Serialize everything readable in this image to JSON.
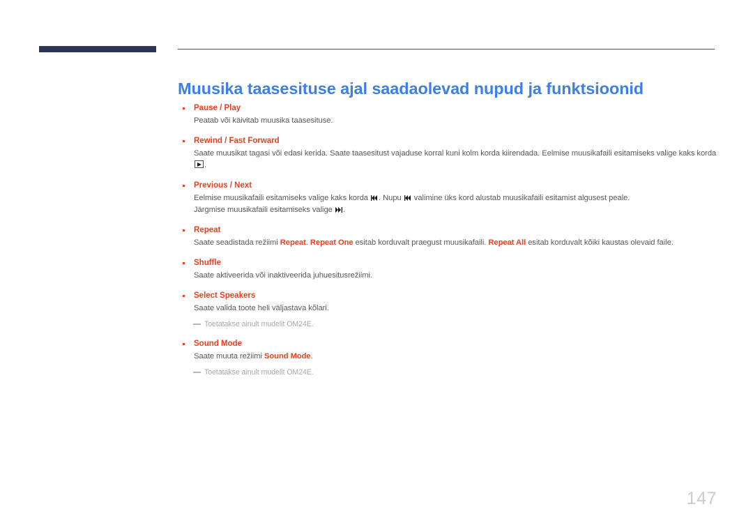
{
  "document": {
    "title": "Muusika taasesituse ajal saadaolevad nupud ja funktsioonid",
    "page_number": "147"
  },
  "colors": {
    "title_blue": "#3d7fe4",
    "accent_orange": "#e8401f",
    "body_gray": "#58585a",
    "note_gray": "#a6a8ab",
    "deco_navy": "#2b3553",
    "page_number_gray": "#c9cbcd"
  },
  "sections": [
    {
      "id": "pause-play",
      "head_primary": "Pause",
      "head_separator": " / ",
      "head_secondary": "Play",
      "lines": [
        {
          "text": "Peatab või käivitab muusika taasesituse."
        }
      ],
      "note": null
    },
    {
      "id": "rewind-fast-forward",
      "head_primary": "Rewind",
      "head_separator": " /  ",
      "head_secondary": "Fast Forward",
      "lines": [
        {
          "text_before": "Saate muusikat tagasi või edasi kerida. Saate taasesitust vajaduse korral kuni kolm korda kiirendada. Eelmise muusikafaili esitamiseks valige kaks korda ",
          "icon": "play-boxed-icon",
          "text_after": "."
        }
      ],
      "note": null
    },
    {
      "id": "previous-next",
      "head_primary": "Previous",
      "head_separator": " / ",
      "head_secondary": "Next",
      "lines": [
        {
          "text_before": "Eelmise muusikafaili esitamiseks valige kaks korda ",
          "icon": "skip-back-icon",
          "text_mid": ". Nupu ",
          "icon2": "skip-back-icon",
          "text_after": " valimine üks kord alustab muusikafaili esitamist algusest peale."
        },
        {
          "text_before": "Järgmise muusikafaili esitamiseks valige ",
          "icon": "skip-forward-icon",
          "text_after": "."
        }
      ],
      "note": null
    },
    {
      "id": "repeat",
      "head_primary": "Repeat",
      "head_separator": "",
      "head_secondary": "",
      "lines": [
        {
          "seg1": "Saate seadistada režiimi ",
          "bold1": "Repeat",
          "seg2": ". ",
          "bold2": "Repeat One",
          "seg3": " esitab korduvalt praegust muusikafaili. ",
          "bold3": "Repeat All",
          "seg4": " esitab korduvalt kõiki kaustas olevaid faile."
        }
      ],
      "note": null
    },
    {
      "id": "shuffle",
      "head_primary": "Shuffle",
      "head_separator": "",
      "head_secondary": "",
      "lines": [
        {
          "text": "Saate aktiveerida või inaktiveerida juhuesitusrežiimi."
        }
      ],
      "note": null
    },
    {
      "id": "select-speakers",
      "head_primary": "Select Speakers",
      "head_separator": "",
      "head_secondary": "",
      "lines": [
        {
          "text": "Saate valida toote heli väljastava kõlari."
        }
      ],
      "note": "Toetatakse ainult mudelit OM24E."
    },
    {
      "id": "sound-mode",
      "head_primary": "Sound Mode",
      "head_separator": "",
      "head_secondary": "",
      "lines": [
        {
          "seg1": "Saate muuta režiimi ",
          "bold1": "Sound Mode",
          "seg2": "."
        }
      ],
      "note": "Toetatakse ainult mudelit OM24E."
    }
  ]
}
